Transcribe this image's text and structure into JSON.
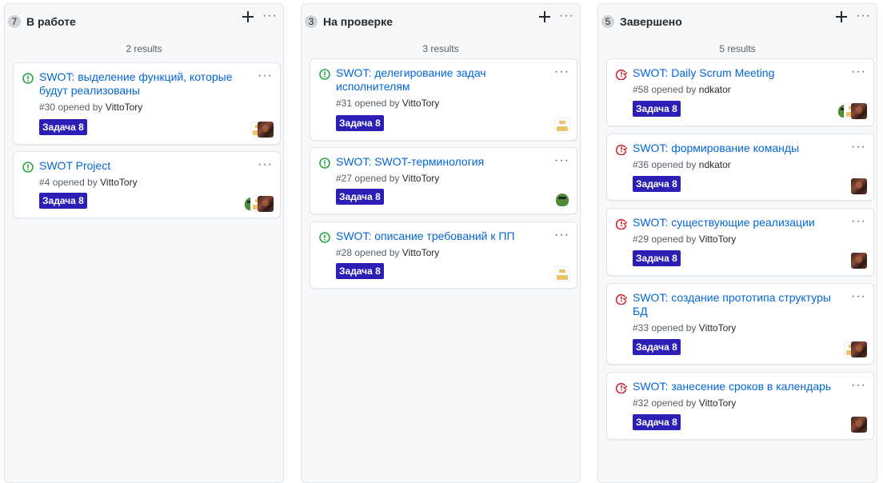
{
  "columns": [
    {
      "count": "7",
      "title": "В работе",
      "results": "2 results",
      "cards": [
        {
          "title": "SWOT: выделение функций, которые будут реализованы",
          "number": "#30",
          "opened_by": "opened by",
          "user": "VittoTory",
          "label": "Задача 8",
          "status": "open"
        },
        {
          "title": "SWOT Project",
          "number": "#4",
          "opened_by": "opened by",
          "user": "VittoTory",
          "label": "Задача 8",
          "status": "open"
        }
      ]
    },
    {
      "count": "3",
      "title": "На проверке",
      "results": "3 results",
      "cards": [
        {
          "title": "SWOT: делегирование задач исполнителям",
          "number": "#31",
          "opened_by": "opened by",
          "user": "VittoTory",
          "label": "Задача 8",
          "status": "open"
        },
        {
          "title": "SWOT: SWOT-терминология",
          "number": "#27",
          "opened_by": "opened by",
          "user": "VittoTory",
          "label": "Задача 8",
          "status": "open"
        },
        {
          "title": "SWOT: описание требований к ПП",
          "number": "#28",
          "opened_by": "opened by",
          "user": "VittoTory",
          "label": "Задача 8",
          "status": "open"
        }
      ]
    },
    {
      "count": "5",
      "title": "Завершено",
      "results": "5 results",
      "cards": [
        {
          "title": "SWOT: Daily Scrum Meeting",
          "number": "#58",
          "opened_by": "opened by",
          "user": "ndkator",
          "label": "Задача 8",
          "status": "closed"
        },
        {
          "title": "SWOT: формирование команды",
          "number": "#36",
          "opened_by": "opened by",
          "user": "ndkator",
          "label": "Задача 8",
          "status": "closed"
        },
        {
          "title": "SWOT: существующие реализации",
          "number": "#29",
          "opened_by": "opened by",
          "user": "VittoTory",
          "label": "Задача 8",
          "status": "closed"
        },
        {
          "title": "SWOT: создание прототипа структуры БД",
          "number": "#33",
          "opened_by": "opened by",
          "user": "VittoTory",
          "label": "Задача 8",
          "status": "closed"
        },
        {
          "title": "SWOT: занесение сроков в календарь",
          "number": "#32",
          "opened_by": "opened by",
          "user": "VittoTory",
          "label": "Задача 8",
          "status": "closed"
        }
      ]
    }
  ],
  "colors": {
    "open_issue": "#28a745",
    "closed_issue": "#cb2431",
    "link": "#0366d6",
    "label_bg": "#2c1fb6"
  },
  "icons": {
    "open_issue": "issue-opened-icon",
    "closed_issue": "issue-closed-icon",
    "add": "plus-icon",
    "menu": "kebab-horizontal-icon"
  }
}
